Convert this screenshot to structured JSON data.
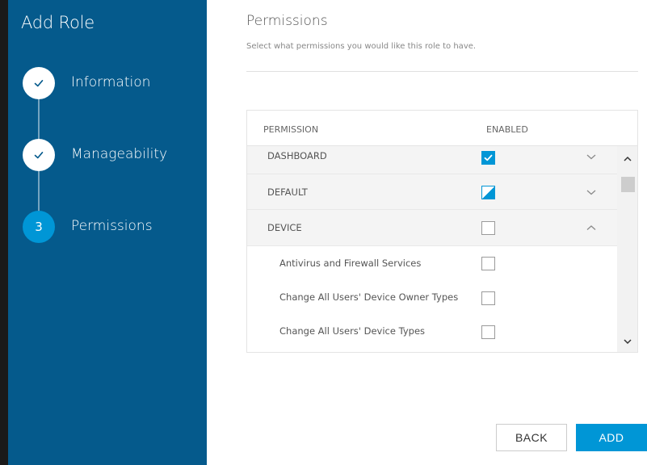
{
  "sidebar": {
    "title": "Add Role",
    "steps": [
      {
        "label": "Information",
        "state": "done"
      },
      {
        "label": "Manageability",
        "state": "done"
      },
      {
        "label": "Permissions",
        "state": "current",
        "number": "3"
      }
    ]
  },
  "main": {
    "title": "Permissions",
    "subtitle": "Select what permissions you would like this role to have."
  },
  "table": {
    "headers": {
      "permission": "PERMISSION",
      "enabled": "ENABLED"
    },
    "rows": [
      {
        "label": "DASHBOARD",
        "type": "group",
        "state": "checked",
        "expanded": false
      },
      {
        "label": "DEFAULT",
        "type": "group",
        "state": "partial",
        "expanded": false
      },
      {
        "label": "DEVICE",
        "type": "group",
        "state": "unchecked",
        "expanded": true
      },
      {
        "label": "Antivirus and Firewall Services",
        "type": "child",
        "state": "unchecked"
      },
      {
        "label": "Change All Users' Device Owner Types",
        "type": "child",
        "state": "unchecked"
      },
      {
        "label": "Change All Users' Device Types",
        "type": "child",
        "state": "unchecked"
      }
    ]
  },
  "buttons": {
    "back": "BACK",
    "add": "ADD"
  },
  "colors": {
    "sidebar": "#055a8c",
    "accent": "#0096d6"
  },
  "icons": {
    "step_done": "check-icon",
    "collapsed": "chevron-down-icon",
    "expanded": "chevron-up-icon",
    "checked": "check-icon"
  }
}
